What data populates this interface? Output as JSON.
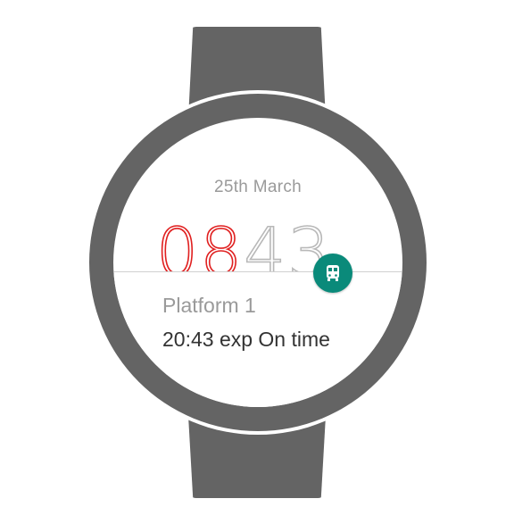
{
  "watch": {
    "date": "25th March",
    "time_hours": "08",
    "time_minutes": "43",
    "notification": {
      "title": "Platform 1",
      "detail": "20:43 exp On time",
      "icon": "train-icon"
    }
  },
  "colors": {
    "hours": "#e02020",
    "minutes": "#b8b8b8",
    "badge": "#0a8a7a",
    "bezel": "#646464"
  }
}
